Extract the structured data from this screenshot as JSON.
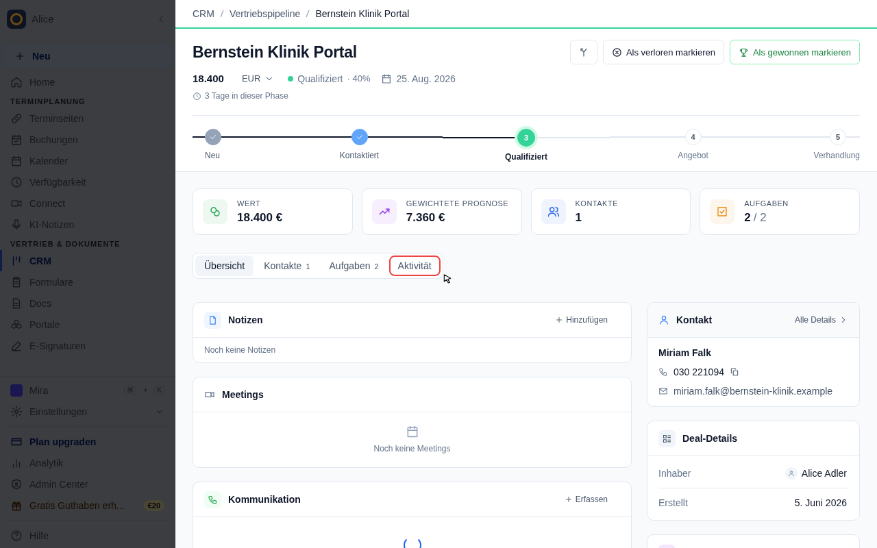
{
  "sidebar": {
    "workspace": "Alice",
    "new_button": "Neu",
    "top_items": [
      {
        "label": "Home",
        "selected": false
      }
    ],
    "sections": [
      {
        "title": "TERMINPLANUNG",
        "items": [
          {
            "label": "Terminseiten",
            "selected": false
          },
          {
            "label": "Buchungen",
            "selected": false
          },
          {
            "label": "Kalender",
            "selected": false
          },
          {
            "label": "Verfügbarkeit",
            "selected": false
          },
          {
            "label": "Connect",
            "selected": false
          },
          {
            "label": "KI-Notizen",
            "selected": false
          }
        ]
      },
      {
        "title": "VERTRIEB & DOKUMENTE",
        "items": [
          {
            "label": "CRM",
            "selected": true
          },
          {
            "label": "Formulare",
            "selected": false
          },
          {
            "label": "Docs",
            "selected": false
          },
          {
            "label": "Portale",
            "selected": false
          },
          {
            "label": "E-Signaturen",
            "selected": false
          }
        ]
      }
    ],
    "assistant": {
      "label": "Mira",
      "shortcut": [
        "⌘",
        "+",
        "K"
      ]
    },
    "settings": {
      "label": "Einstellungen",
      "expanded": false
    },
    "bottom_items": [
      {
        "label": "Plan upgraden",
        "kind": "upgrade"
      },
      {
        "label": "Analytik",
        "kind": "plain"
      },
      {
        "label": "Admin Center",
        "kind": "plain"
      },
      {
        "label": "Gratis Guthaben erh...",
        "kind": "promo",
        "badge": "€20"
      }
    ],
    "help": "Hilfe"
  },
  "breadcrumb": [
    "CRM",
    "Vertriebspipeline",
    "Bernstein Klinik Portal"
  ],
  "deal": {
    "title": "Bernstein Klinik Portal",
    "amount": "18.400",
    "currency": "EUR",
    "stage": "Qualifiziert",
    "probability": "· 40%",
    "close_date": "25. Aug. 2026",
    "time_in_stage": "3 Tage in dieser Phase",
    "actions": [
      {
        "kind": "icon"
      },
      {
        "kind": "lost",
        "label": "Als verloren markieren"
      },
      {
        "kind": "won",
        "label": "Als gewonnen markieren"
      }
    ]
  },
  "stages": [
    {
      "label": "Neu",
      "completed": true,
      "current": false,
      "color": "#94a3b8"
    },
    {
      "label": "Kontaktiert",
      "completed": true,
      "current": false,
      "color": "#60a5fa"
    },
    {
      "number": "3",
      "label": "Qualifiziert",
      "completed": false,
      "current": true,
      "color": "#34d399"
    },
    {
      "number": "4",
      "label": "Angebot",
      "completed": false,
      "current": false
    },
    {
      "number": "5",
      "label": "Verhandlung",
      "completed": false,
      "current": false
    }
  ],
  "stats": [
    {
      "label": "WERT",
      "value": "18.400 €",
      "color": "#16a34a"
    },
    {
      "label": "GEWICHTETE PROGNOSE",
      "value": "7.360 €",
      "color": "#9333ea"
    },
    {
      "label": "KONTAKTE",
      "value": "1",
      "color": "#2563eb"
    },
    {
      "label": "AUFGABEN",
      "value": "2",
      "total": "/ 2",
      "color": "#ea8a0c"
    }
  ],
  "tabs": [
    {
      "label": "Übersicht",
      "selected": true,
      "highlighted": false
    },
    {
      "label": "Kontakte",
      "count": "1",
      "selected": false,
      "highlighted": false
    },
    {
      "label": "Aufgaben",
      "count": "2",
      "selected": false,
      "highlighted": false
    },
    {
      "label": "Aktivität",
      "selected": false,
      "highlighted": true
    }
  ],
  "notes": {
    "title": "Notizen",
    "action": "Hinzufügen",
    "empty": "Noch keine Notizen"
  },
  "meetings": {
    "title": "Meetings",
    "empty": "Noch keine Meetings"
  },
  "communication": {
    "title": "Kommunikation",
    "action": "Erfassen",
    "loading": true
  },
  "contact": {
    "title": "Kontakt",
    "link": "Alle Details",
    "name": "Miriam Falk",
    "phone": "030 221094",
    "email": "miriam.falk@bernstein-klinik.example"
  },
  "deal_details": {
    "title": "Deal-Details",
    "rows": [
      {
        "label": "Inhaber",
        "value": "Alice Adler",
        "kind": "person"
      },
      {
        "label": "Erstellt",
        "value": "5. Juni 2026",
        "kind": "text"
      }
    ]
  }
}
